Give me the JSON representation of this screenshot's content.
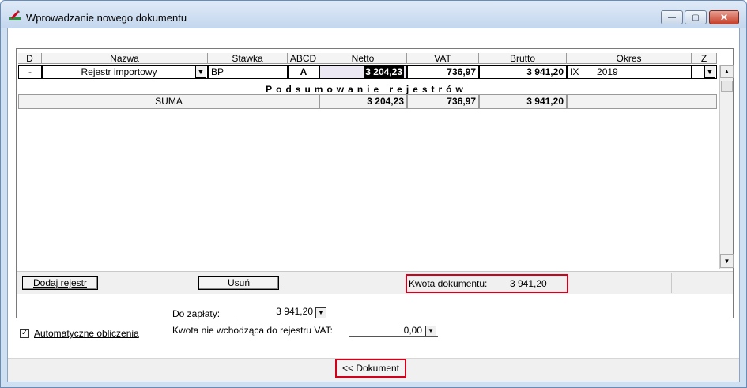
{
  "window": {
    "title": "Wprowadzanie nowego dokumentu",
    "controls": {
      "minimize": "—",
      "maximize": "▢",
      "close": "✕"
    }
  },
  "table": {
    "headers": [
      "D",
      "Nazwa",
      "Stawka",
      "ABCD",
      "Netto",
      "VAT",
      "Brutto",
      "Okres",
      "Z"
    ],
    "row": {
      "d": "-",
      "nazwa": "Rejestr importowy",
      "stawka": "BP",
      "abcd": "A",
      "netto": "3 204,23",
      "vat": "736,97",
      "brutto": "3 941,20",
      "okres_month": "IX",
      "okres_year": "2019"
    },
    "summary_title": "Podsumowanie rejestrów",
    "sum": {
      "label": "SUMA",
      "netto": "3 204,23",
      "vat": "736,97",
      "brutto": "3 941,20"
    }
  },
  "bottom": {
    "add_register": "Dodaj rejestr",
    "remove": "Usuń",
    "kwota_label": "Kwota dokumentu:",
    "kwota_value": "3 941,20"
  },
  "form": {
    "do_zaplaty_label": "Do zapłaty:",
    "do_zaplaty_value": "3 941,20",
    "auto_calc_label": "Automatyczne obliczenia",
    "auto_calc_checked": true,
    "kwota_nie_label": "Kwota nie wchodząca do rejestru VAT:",
    "kwota_nie_value": "0,00"
  },
  "footer": {
    "document_button": "<< Dokument"
  },
  "icons": {
    "app_icon": "pen-icon",
    "dropdown": "▼",
    "scroll_up": "▲",
    "scroll_down": "▼",
    "check": "✓"
  },
  "colors": {
    "highlight": "#d0021b",
    "title_bar": "#c4d7ee"
  }
}
